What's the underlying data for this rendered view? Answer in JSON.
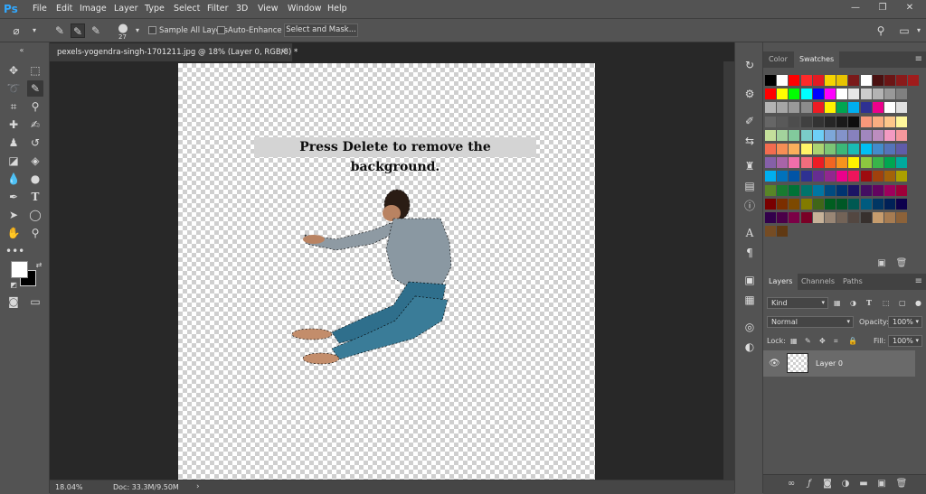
{
  "app": {
    "logo": "Ps"
  },
  "menu": [
    "File",
    "Edit",
    "Image",
    "Layer",
    "Type",
    "Select",
    "Filter",
    "3D",
    "View",
    "Window",
    "Help"
  ],
  "window_controls": {
    "minimize": "—",
    "restore": "❐",
    "close": "✕"
  },
  "options_bar": {
    "brush_size": "27",
    "sample_all_layers": "Sample All Layers",
    "auto_enhance": "Auto-Enhance",
    "select_and_mask": "Select and Mask..."
  },
  "document": {
    "tab_title": "pexels-yogendra-singh-1701211.jpg @ 18% (Layer 0, RGB/8) *",
    "tab_close": "✕",
    "instruction": "Press Delete to remove the background."
  },
  "status": {
    "zoom": "18.04%",
    "doc": "Doc: 33.3M/9.50M",
    "arrow": "›"
  },
  "swatches_panel": {
    "tabs": [
      "Color",
      "Swatches"
    ],
    "active_tab": "Swatches",
    "rows": [
      [
        "#000000",
        "#ffffff",
        "#ff0000",
        "#ff2a2a",
        "#e31b23",
        "#f5d400",
        "#e8c300",
        "#7a1a1a",
        "#ffffff",
        "#4a1010",
        "#6b1515",
        "#8a1a1a",
        "#a01c1c"
      ],
      [
        "#ff0000",
        "#ffff00",
        "#00ff00",
        "#00ffff",
        "#0000ff",
        "#ff00ff",
        "#ffffff",
        "#e6e6e6",
        "#cccccc",
        "#b3b3b3",
        "#999999",
        "#808080"
      ],
      [
        "#b3b3b3",
        "#a6a6a6",
        "#999999",
        "#8c8c8c",
        "#ed1c24",
        "#fff200",
        "#00a651",
        "#00aeef",
        "#2e3192",
        "#ec008c",
        "#ffffff",
        "#e0e0e0"
      ],
      [
        "#666666",
        "#595959",
        "#4d4d4d",
        "#404040",
        "#333333",
        "#262626",
        "#1a1a1a",
        "#0d0d0d",
        "#f7977a",
        "#f9ad81",
        "#fdc68a",
        "#fff79a"
      ],
      [
        "#c4df9b",
        "#a3d39c",
        "#82ca9c",
        "#7accc8",
        "#6dcff6",
        "#7da7d9",
        "#8393ca",
        "#8781bd",
        "#a187be",
        "#bc8dbf",
        "#f49ac2",
        "#f6989d"
      ],
      [
        "#f26c4f",
        "#f68e55",
        "#fbaf5c",
        "#fff467",
        "#acd372",
        "#7cc576",
        "#3bb878",
        "#1abbb4",
        "#00bff3",
        "#438ccb",
        "#5574b9",
        "#605ca8"
      ],
      [
        "#8560a8",
        "#a864a8",
        "#f06eaa",
        "#f26d7d",
        "#ed1c24",
        "#f26522",
        "#f7941d",
        "#fff200",
        "#8dc73f",
        "#39b54a",
        "#00a651",
        "#00a99d"
      ],
      [
        "#00aeef",
        "#0072bc",
        "#0054a6",
        "#2e3192",
        "#662d91",
        "#92278f",
        "#ec008c",
        "#ed145b",
        "#9e0b0f",
        "#a0410d",
        "#a36209",
        "#aba000"
      ],
      [
        "#598527",
        "#197b30",
        "#007236",
        "#00746b",
        "#0076a3",
        "#004b80",
        "#003471",
        "#1b1464",
        "#440e62",
        "#630460",
        "#9e005d",
        "#9e0039"
      ],
      [
        "#790000",
        "#7b2e00",
        "#7d4900",
        "#827b00",
        "#406618",
        "#005e20",
        "#005826",
        "#005952",
        "#005b7f",
        "#003663",
        "#002157",
        "#0d004c"
      ],
      [
        "#32004b",
        "#4b0049",
        "#7b0046",
        "#7a0026",
        "#c7b299",
        "#998675",
        "#736357",
        "#534741",
        "#37302d",
        "#c69c6d",
        "#a67c52",
        "#8c6239"
      ],
      [
        "#754c24",
        "#603913"
      ]
    ]
  },
  "layers_panel": {
    "tabs": [
      "Layers",
      "Channels",
      "Paths"
    ],
    "active_tab": "Layers",
    "filter_kind": "Kind",
    "blend_mode": "Normal",
    "opacity_label": "Opacity:",
    "opacity_value": "100%",
    "lock_label": "Lock:",
    "fill_label": "Fill:",
    "fill_value": "100%",
    "layer_name": "Layer 0"
  },
  "colors": {
    "accent": "#31a8ff"
  }
}
